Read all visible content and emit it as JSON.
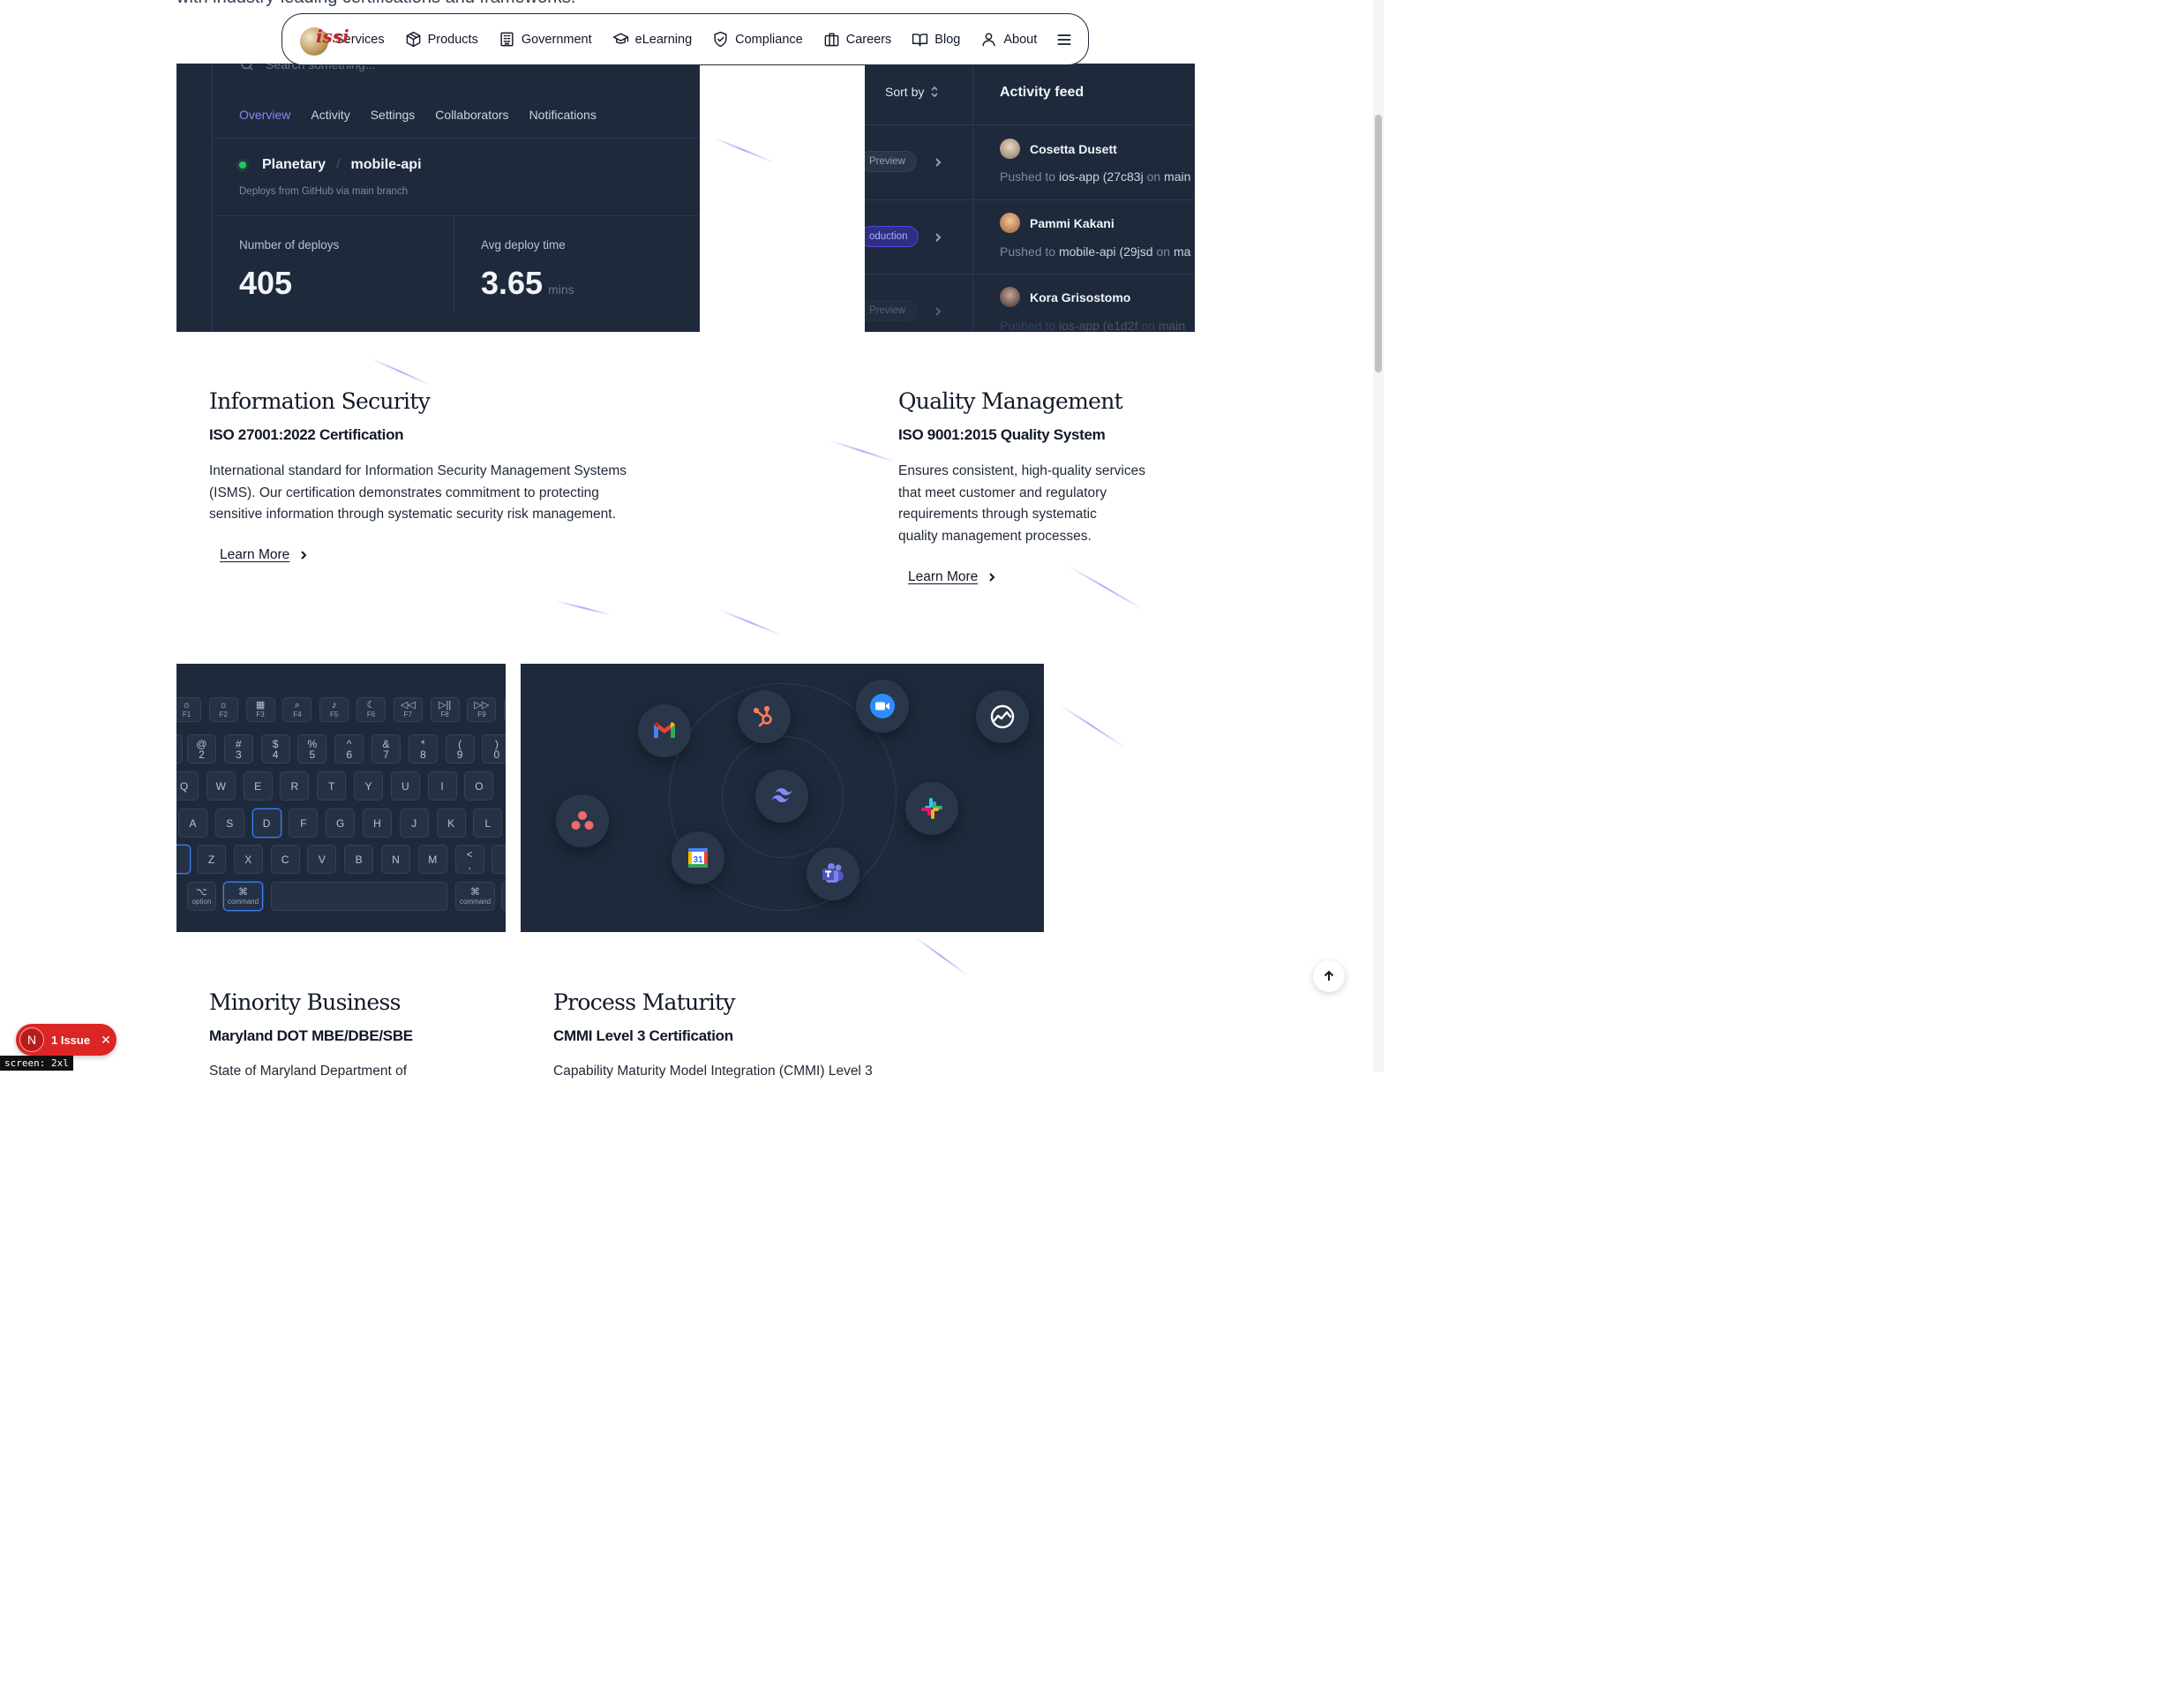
{
  "intro": {
    "text": "with industry-leading certifications and frameworks."
  },
  "nav": {
    "logo_text": "issi",
    "items": [
      {
        "label": "Services",
        "icon": "wrench-icon"
      },
      {
        "label": "Products",
        "icon": "box-icon"
      },
      {
        "label": "Government",
        "icon": "building-icon"
      },
      {
        "label": "eLearning",
        "icon": "graduation-cap-icon"
      },
      {
        "label": "Compliance",
        "icon": "shield-check-icon"
      },
      {
        "label": "Careers",
        "icon": "briefcase-icon"
      },
      {
        "label": "Blog",
        "icon": "book-open-icon"
      },
      {
        "label": "About",
        "icon": "user-icon"
      }
    ],
    "menu_icon": "hamburger-menu-icon"
  },
  "dashboard": {
    "search_placeholder": "Search something...",
    "tabs": [
      "Overview",
      "Activity",
      "Settings",
      "Collaborators",
      "Notifications"
    ],
    "active_tab": "Overview",
    "repo_owner": "Planetary",
    "repo_sep": "/",
    "repo_name": "mobile-api",
    "repo_sub": "Deploys from GitHub via main branch",
    "stats": [
      {
        "label": "Number of deploys",
        "value": "405",
        "unit": ""
      },
      {
        "label": "Avg deploy time",
        "value": "3.65",
        "unit": "mins"
      }
    ]
  },
  "activity": {
    "sort_label": "Sort by",
    "title": "Activity feed",
    "envs": [
      "Preview",
      "oduction",
      "Preview"
    ],
    "entries": [
      {
        "name": "Cosetta Dusett",
        "prefix": "Pushed to",
        "repo": "ios-app",
        "commit": "(27c83j",
        "mid": "on",
        "branch": "main"
      },
      {
        "name": "Pammi Kakani",
        "prefix": "Pushed to",
        "repo": "mobile-api",
        "commit": "(29jsd",
        "mid": "on",
        "branch": "ma"
      },
      {
        "name": "Kora Grisostomo",
        "prefix": "Pushed to",
        "repo": "ios-app",
        "commit": "(e1d2f",
        "mid": "on",
        "branch": "main"
      }
    ]
  },
  "sections": [
    {
      "title": "Information Security",
      "subtitle": "ISO 27001:2022 Certification",
      "body": [
        "International standard for Information Security Management Systems",
        "(ISMS). Our certification demonstrates commitment to protecting",
        "sensitive information through systematic security risk management."
      ],
      "link": "Learn More"
    },
    {
      "title": "Quality Management",
      "subtitle": "ISO 9001:2015 Quality System",
      "body": [
        "Ensures consistent, high-quality services",
        "that meet customer and regulatory",
        "requirements through systematic",
        "quality management processes."
      ],
      "link": "Learn More"
    },
    {
      "title": "Minority Business",
      "subtitle": "Maryland DOT MBE/DBE/SBE",
      "body_partial": "State of Maryland Department of"
    },
    {
      "title": "Process Maturity",
      "subtitle": "CMMI Level 3 Certification",
      "body_partial": "Capability Maturity Model Integration (CMMI) Level 3"
    }
  ],
  "keyboard": {
    "fn_row": [
      {
        "sym": "☼",
        "label": "F1"
      },
      {
        "sym": "☼",
        "label": "F2"
      },
      {
        "sym": "▦",
        "label": "F3"
      },
      {
        "sym": "⌕",
        "label": "F4"
      },
      {
        "sym": "♪",
        "label": "F5"
      },
      {
        "sym": "☾",
        "label": "F6"
      },
      {
        "sym": "◁◁",
        "label": "F7"
      },
      {
        "sym": "▷||",
        "label": "F8"
      },
      {
        "sym": "▷▷",
        "label": "F9"
      }
    ],
    "num_row": [
      {
        "top": "@",
        "bot": "2"
      },
      {
        "top": "#",
        "bot": "3"
      },
      {
        "top": "$",
        "bot": "4"
      },
      {
        "top": "%",
        "bot": "5"
      },
      {
        "top": "^",
        "bot": "6"
      },
      {
        "top": "&",
        "bot": "7"
      },
      {
        "top": "*",
        "bot": "8"
      },
      {
        "top": "(",
        "bot": "9"
      },
      {
        "top": ")",
        "bot": "0"
      }
    ],
    "row_q": [
      "Q",
      "W",
      "E",
      "R",
      "T",
      "Y",
      "U",
      "I",
      "O"
    ],
    "row_a": [
      "A",
      "S",
      "D",
      "F",
      "G",
      "H",
      "J",
      "K",
      "L"
    ],
    "row_z": [
      "Z",
      "X",
      "C",
      "V",
      "B",
      "N",
      "M"
    ],
    "comma_key": {
      "top": "<",
      "bot": ","
    },
    "highlighted": [
      "D",
      "command-left"
    ],
    "option": {
      "sym": "⌥",
      "label": "option"
    },
    "command": {
      "sym": "⌘",
      "label": "command"
    }
  },
  "integrations": {
    "center_icon": "tailwind-icon",
    "apps": [
      "gmail-icon",
      "hubspot-icon",
      "zoom-icon",
      "basecamp-icon",
      "asana-icon",
      "slack-icon",
      "google-calendar-icon",
      "teams-icon"
    ],
    "calendar_day": "31"
  },
  "colors": {
    "dark_panel": "#1e293b",
    "accent_indigo": "#818cf8",
    "status_green": "#22c55e",
    "issue_red": "#dc2626"
  },
  "overlay": {
    "issue_letter": "N",
    "issue_label": "1 Issue",
    "screen_tag": "screen: 2xl"
  }
}
